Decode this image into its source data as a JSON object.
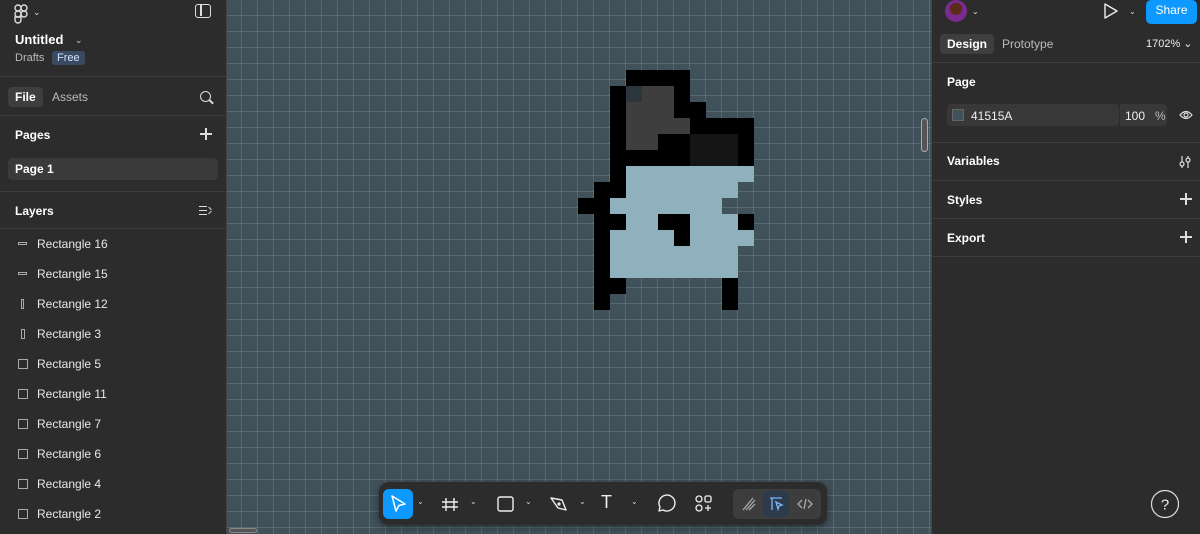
{
  "file": {
    "title": "Untitled",
    "location": "Drafts",
    "plan_badge": "Free"
  },
  "left_tabs": [
    "File",
    "Assets"
  ],
  "pages": {
    "header": "Pages",
    "items": [
      "Page 1"
    ]
  },
  "layers": {
    "header": "Layers",
    "items": [
      {
        "name": "Rectangle 16",
        "shape": "h"
      },
      {
        "name": "Rectangle 15",
        "shape": "h"
      },
      {
        "name": "Rectangle 12",
        "shape": "v"
      },
      {
        "name": "Rectangle 3",
        "shape": "vv"
      },
      {
        "name": "Rectangle 5",
        "shape": "sq"
      },
      {
        "name": "Rectangle 11",
        "shape": "sq"
      },
      {
        "name": "Rectangle 7",
        "shape": "sq"
      },
      {
        "name": "Rectangle 6",
        "shape": "sq"
      },
      {
        "name": "Rectangle 4",
        "shape": "sq"
      },
      {
        "name": "Rectangle 2",
        "shape": "sq"
      }
    ]
  },
  "right_panel": {
    "share_label": "Share",
    "tabs": [
      "Design",
      "Prototype"
    ],
    "zoom": "1702% ⌄",
    "page_section": {
      "title": "Page",
      "color_hex": "41515A",
      "opacity": "100",
      "opacity_unit": "%"
    },
    "sections": [
      "Variables",
      "Styles",
      "Export"
    ]
  },
  "canvas": {
    "background_color": "#41515a",
    "pixel_colors": {
      "b": "#000000",
      "d": "#3e3e3e",
      "k": "#151515",
      "s": "#2c373d",
      "l": "#8fb1bd"
    },
    "pixel_rows": [
      "..........bbbb....",
      ".........bsddb....",
      ".........bdddbb...",
      ".........bddddbbbb",
      ".........bddbbkkkb",
      ".........bbbbbkkkb",
      ".........bllllllll",
      "........bblllllll.",
      ".......bblllllll..",
      "........bbllbblllb",
      "........bllllbllll",
      "........bllllllll.",
      "........bllllllll.",
      "........bb......b.",
      "........b.......b."
    ]
  },
  "toolbar": {
    "tools": [
      "move-tool",
      "frame-tool",
      "shape-tool",
      "pen-tool",
      "text-tool",
      "comment-tool",
      "actions-tool"
    ],
    "text_glyph": "T"
  },
  "help_label": "?"
}
